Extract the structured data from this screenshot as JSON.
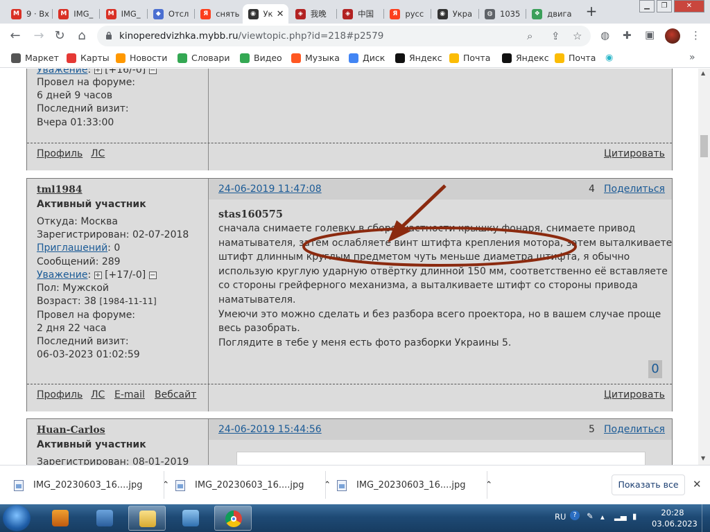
{
  "tabs": [
    {
      "label": "9 · Вх",
      "icon": "gmail-icon",
      "color": "#d93025"
    },
    {
      "label": "IMG_",
      "icon": "gmail-icon",
      "color": "#d93025"
    },
    {
      "label": "IMG_",
      "icon": "gmail-icon",
      "color": "#d93025"
    },
    {
      "label": "Отсл",
      "icon": "box-icon",
      "color": "#4b6fd1"
    },
    {
      "label": "снять",
      "icon": "yandex-icon",
      "color": "#fc3f1d"
    },
    {
      "label": "Ук",
      "icon": "film-icon",
      "color": "#333333",
      "active": true
    },
    {
      "label": "我晚",
      "icon": "site-icon",
      "color": "#b22222"
    },
    {
      "label": "中国",
      "icon": "site-icon",
      "color": "#b22222"
    },
    {
      "label": "русс",
      "icon": "yandex-icon",
      "color": "#fc3f1d"
    },
    {
      "label": "Укра",
      "icon": "film-icon",
      "color": "#333333"
    },
    {
      "label": "1035",
      "icon": "globe-icon",
      "color": "#5f6368"
    },
    {
      "label": "двига",
      "icon": "apps-icon",
      "color": "#3b9f5a"
    }
  ],
  "address": {
    "host": "kinoperedvizhka.mybb.ru",
    "path": "/viewtopic.php?id=218#p2579"
  },
  "bookmarks": [
    {
      "label": "Маркет",
      "color": "#555555"
    },
    {
      "label": "Карты",
      "color": "#e53935"
    },
    {
      "label": "Новости",
      "color": "#ff9800"
    },
    {
      "label": "Словари",
      "color": "#34a853"
    },
    {
      "label": "Видео",
      "color": "#34a853"
    },
    {
      "label": "Музыка",
      "color": "#ff5722"
    },
    {
      "label": "Диск",
      "color": "#4285f4"
    },
    {
      "label": "Яндекс",
      "color": "#111111"
    },
    {
      "label": "Почта",
      "color": "#fbbc05"
    },
    {
      "label": "Яндекс",
      "color": "#111111"
    },
    {
      "label": "Почта",
      "color": "#fbbc05"
    }
  ],
  "post1": {
    "respect_label": "Уважение",
    "respect_value": "[+16/-0]",
    "forum_time_label": "Провел на форуме:",
    "forum_time": "6 дней 9 часов",
    "last_visit_label": "Последний визит:",
    "last_visit": "Вчера 01:33:00",
    "links": [
      "Профиль",
      "ЛС"
    ],
    "quote": "Цитировать"
  },
  "post2": {
    "username": "tml1984",
    "rank": "Активный участник",
    "from": "Откуда: Москва",
    "registered": "Зарегистрирован: 02-07-2018",
    "invites_label": "Приглашений",
    "invites": ": 0",
    "messages": "Сообщений: 289",
    "respect_label": "Уважение",
    "respect_value": "[+17/-0]",
    "gender": "Пол: Мужской",
    "age": "Возраст: 38",
    "birth": "[1984-11-11]",
    "forum_time_label": "Провел на форуме:",
    "forum_time": "2 дня 22 часа",
    "last_visit_label": "Последний визит:",
    "last_visit": "06-03-2023 01:02:59",
    "date": "24-06-2019 11:47:08",
    "number": "4",
    "share": "Поделиться",
    "quote_author": "stas160575",
    "lines": [
      "сначала снимаете голевку в сборе, частности крышку фонаря, снимаете привод",
      "наматывателя, затем ослабляете винт штифта крепления мотора, затем выталкиваете",
      "штифт длинным круглым предметом чуть меньше диаметра штифта, я обычно",
      "использую круглую ударную отвёртку длинной 150 мм, соответственно её вставляете",
      "со стороны грейферного механизма, а выталкиваете штифт со стороны привода",
      "наматывателя.",
      "Умеючи это можно сделать и без разбора всего проектора, но в вашем случае проще",
      "весь разобрать.",
      "Поглядите в тебе у меня есть фото разборки Украины 5."
    ],
    "likes": "0",
    "links": [
      "Профиль",
      "ЛС",
      "E-mail",
      "Вебсайт"
    ],
    "quote": "Цитировать"
  },
  "post3": {
    "username": "Huan-Carlos",
    "rank": "Активный участник",
    "registered": "Зарегистрирован: 08-01-2019",
    "date": "24-06-2019 15:44:56",
    "number": "5",
    "share": "Поделиться"
  },
  "downloads": [
    "IMG_20230603_16....jpg",
    "IMG_20230603_16....jpg",
    "IMG_20230603_16....jpg"
  ],
  "show_all": "Показать все",
  "tray": {
    "lang": "RU",
    "time": "20:28",
    "date": "03.06.2023"
  },
  "annotation_color": "#8b2a0f"
}
